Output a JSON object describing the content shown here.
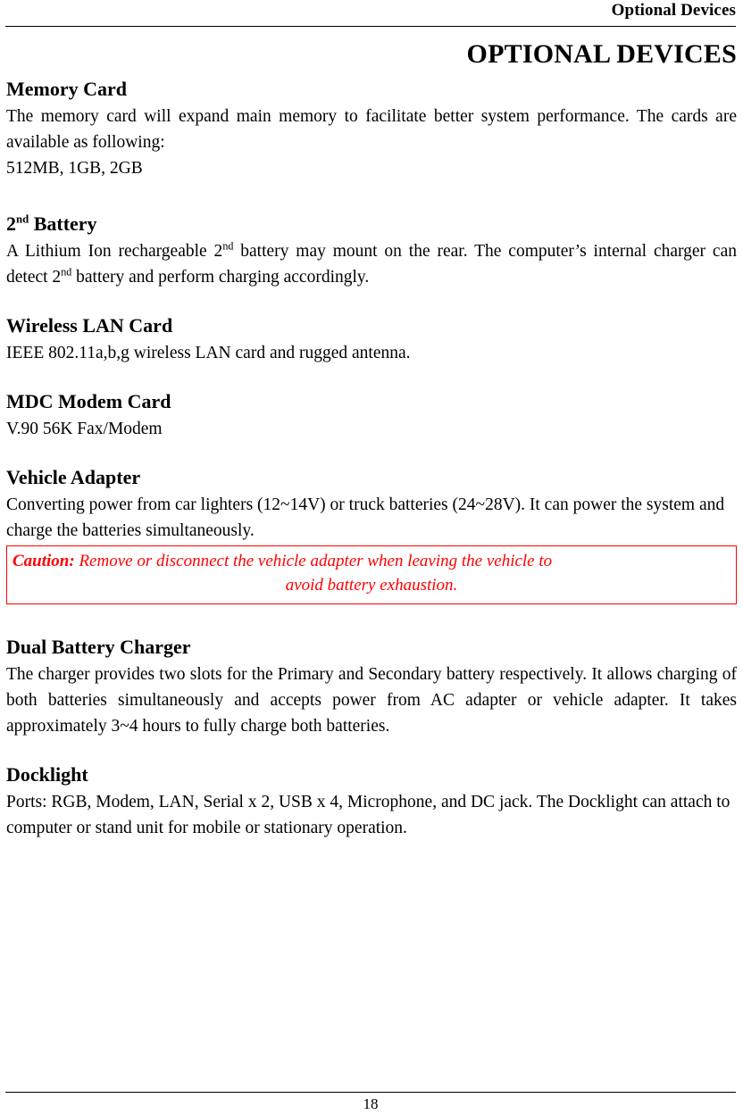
{
  "header": {
    "running_title": "Optional Devices"
  },
  "document": {
    "title": "OPTIONAL DEVICES"
  },
  "sections": [
    {
      "heading": "Memory Card",
      "heading_prefix": "",
      "heading_sup": "",
      "paragraphs": [
        "The memory card will expand main memory to facilitate better system performance. The cards are available as following:",
        "512MB, 1GB, 2GB"
      ]
    },
    {
      "heading_prefix": "2",
      "heading_sup": "nd",
      "heading": " Battery",
      "paragraphs": []
    },
    {
      "heading": "Wireless LAN Card",
      "paragraphs": [
        "IEEE 802.11a,b,g wireless LAN card and rugged antenna."
      ]
    },
    {
      "heading": "MDC Modem Card",
      "paragraphs": [
        "V.90 56K Fax/Modem"
      ]
    },
    {
      "heading": "Vehicle Adapter",
      "paragraphs": [
        "Converting power from car lighters (12~14V) or truck batteries (24~28V). It can power the system and charge the batteries simultaneously."
      ]
    },
    {
      "heading": "Dual Battery Charger",
      "paragraphs": [
        "The charger provides two slots for the Primary and Secondary battery respectively. It allows charging of both batteries simultaneously and accepts power from AC adapter or vehicle adapter. It takes approximately 3~4 hours to fully charge both batteries."
      ]
    },
    {
      "heading": "Docklight",
      "paragraphs": [
        "Ports: RGB, Modem, LAN, Serial x 2, USB x 4, Microphone, and DC jack. The Docklight can attach to computer or stand unit for mobile or stationary operation."
      ]
    }
  ],
  "battery_section": {
    "heading_number": "2",
    "heading_sup": "nd",
    "heading_rest": " Battery",
    "text_part1": "A Lithium Ion rechargeable 2",
    "sup1": "nd",
    "text_part2": " battery may mount on the rear. The computer’s internal charger can detect 2",
    "sup2": "nd",
    "text_part3": " battery and perform charging accordingly."
  },
  "caution": {
    "label": "Caution:",
    "line1": " Remove or disconnect the vehicle adapter when leaving the vehicle to",
    "line2": "avoid battery exhaustion.",
    "color": "#FF0000"
  },
  "footer": {
    "page_number": "18"
  }
}
